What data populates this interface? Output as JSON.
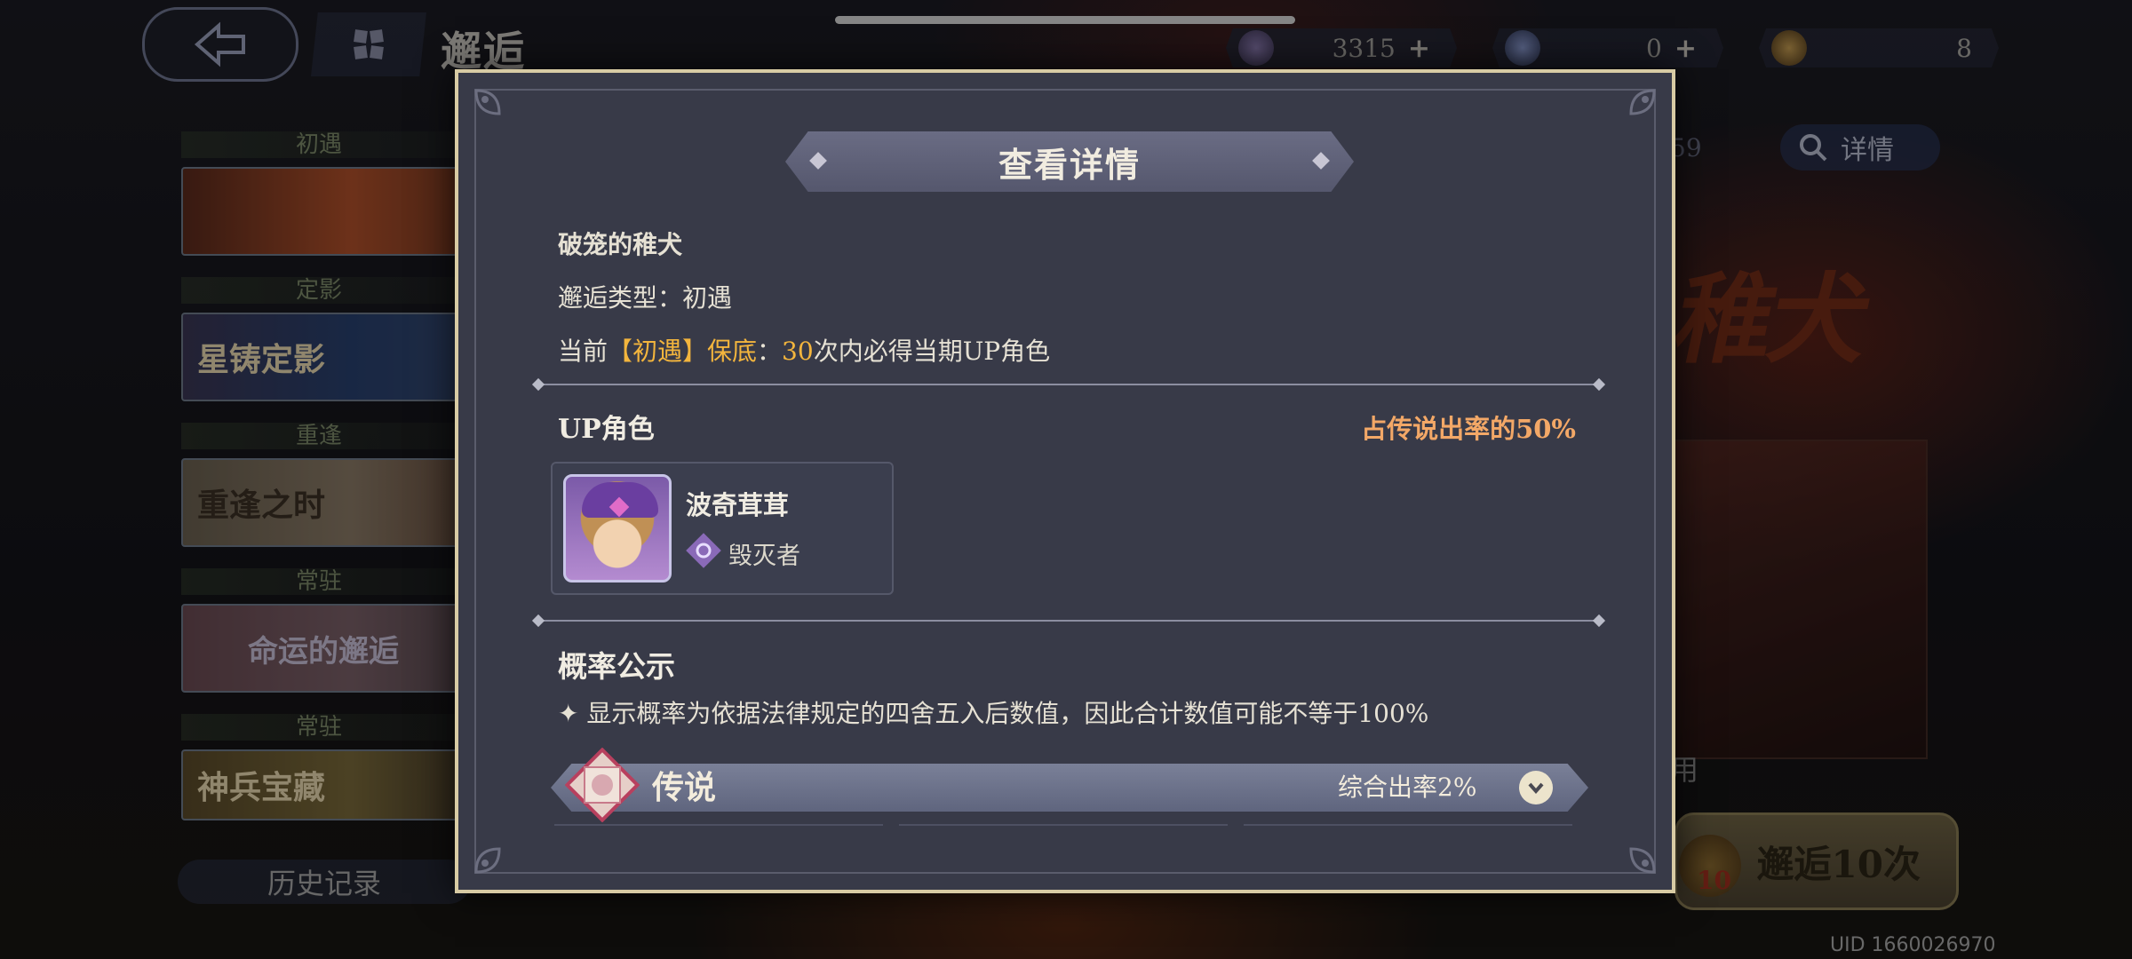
{
  "screen": {
    "title": "邂逅",
    "uid": "UID 1660026970"
  },
  "currencies": [
    {
      "name": "gem-icon",
      "value": "3315",
      "plus": "+"
    },
    {
      "name": "ticket-icon",
      "value": "0",
      "plus": "+"
    },
    {
      "name": "coin-icon",
      "value": "8"
    }
  ],
  "banners": [
    {
      "category": "初遇",
      "card_text": ""
    },
    {
      "category": "定影",
      "card_text": "星铸定影"
    },
    {
      "category": "重逢",
      "card_text": "重逢之时"
    },
    {
      "category": "常驻",
      "card_text": "命运的邂逅"
    },
    {
      "category": "常驻",
      "card_text": "神兵宝藏"
    }
  ],
  "history_label": "历史记录",
  "right_panel": {
    "detail_label": "详情",
    "detail_number": "59",
    "art_title": "稚犬",
    "use_text": "用",
    "pull_button": "邂逅10次",
    "pull_badge": "10"
  },
  "modal": {
    "title": "查看详情",
    "banner_name": "破笼的稚犬",
    "type_label": "邂逅类型：",
    "type_value": "初遇",
    "pity_prefix": "当前",
    "pity_highlight": "【初遇】保底",
    "pity_colon": "：",
    "pity_count": "30",
    "pity_suffix": "次内必得当期UP角色",
    "up_section_title": "UP角色",
    "up_rate": "占传说出率的50%",
    "up_character": {
      "name": "波奇茸茸",
      "class": "毁灭者",
      "class_icon": "destroyer-class-icon"
    },
    "probability_title": "概率公示",
    "probability_notice": "✦ 显示概率为依据法律规定的四舍五入后数值，因此合计数值可能不等于100%",
    "rarity_tier": {
      "label": "传说",
      "rate": "综合出率2%"
    }
  },
  "colors": {
    "accent_gold": "#f3b53d",
    "up_rate_orange": "#f3a867",
    "modal_bg": "#383a48",
    "modal_border": "#d8cba4"
  }
}
